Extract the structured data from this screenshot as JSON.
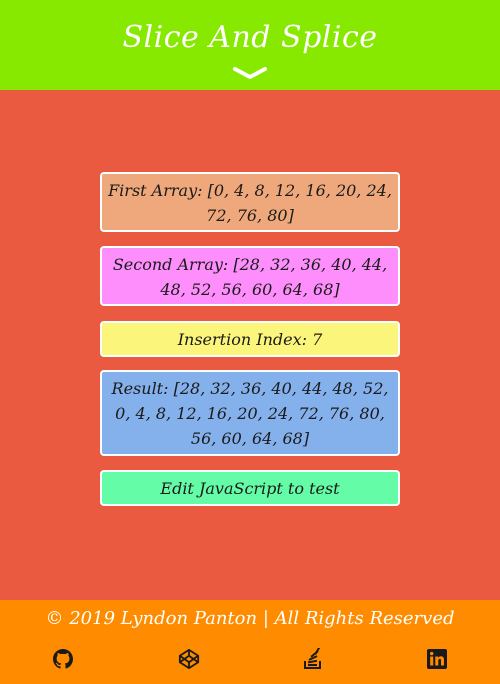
{
  "header": {
    "title": "Slice And Splice",
    "scroll_icon": "chevron-down-icon"
  },
  "cards": {
    "first_array": "First Array: [0, 4, 8, 12, 16, 20, 24, 72, 76, 80]",
    "second_array": "Second Array: [28, 32, 36, 40, 44, 48, 52, 56, 60, 64, 68]",
    "insertion_index": "Insertion Index: 7",
    "result": "Result: [28, 32, 36, 40, 44, 48, 52, 0, 4, 8, 12, 16, 20, 24, 72, 76, 80, 56, 60, 64, 68]",
    "edit_link": "Edit JavaScript to test"
  },
  "footer": {
    "copyright": "© 2019 Lyndon Panton | All Rights Reserved",
    "icons": [
      "github-icon",
      "codepen-icon",
      "stackoverflow-icon",
      "linkedin-icon"
    ]
  },
  "colors": {
    "header_bg": "#87e800",
    "body_bg": "#e95a40",
    "footer_bg": "#ff8c00",
    "first_array_bg": "#eea87c",
    "second_array_bg": "#fd8efb",
    "insertion_index_bg": "#fbf57c",
    "result_bg": "#84b0eb",
    "edit_bg": "#64fca6"
  }
}
